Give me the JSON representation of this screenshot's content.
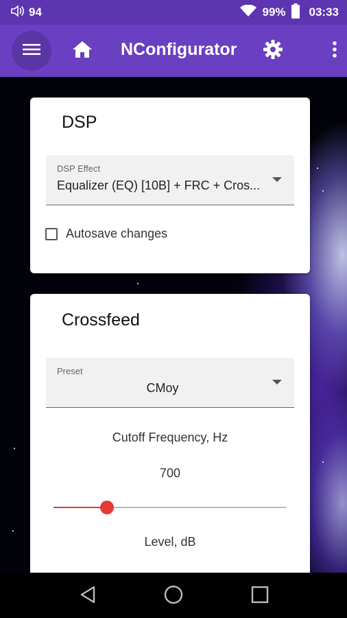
{
  "status_bar": {
    "volume_level": "94",
    "battery_percent": "99%",
    "time": "03:33"
  },
  "app_bar": {
    "title": "NConfigurator"
  },
  "dsp_card": {
    "title": "DSP",
    "effect_select": {
      "label": "DSP Effect",
      "value": "Equalizer (EQ) [10B] + FRC + Cros..."
    },
    "autosave": {
      "label": "Autosave changes",
      "checked": false
    }
  },
  "crossfeed_card": {
    "title": "Crossfeed",
    "preset_select": {
      "label": "Preset",
      "value": "CMoy"
    },
    "cutoff": {
      "label": "Cutoff Frequency, Hz",
      "value": "700",
      "slider_fraction": 0.23
    },
    "level": {
      "label": "Level, dB"
    }
  },
  "colors": {
    "app_bar": "#6a3fc1",
    "status_bar": "#5e35b1",
    "accent": "#e53935"
  },
  "icons": [
    "volume-icon",
    "wifi-icon",
    "battery-icon",
    "menu-icon",
    "home-icon",
    "gear-icon",
    "more-vert-icon",
    "back-icon",
    "home-circle-icon",
    "recents-icon"
  ]
}
